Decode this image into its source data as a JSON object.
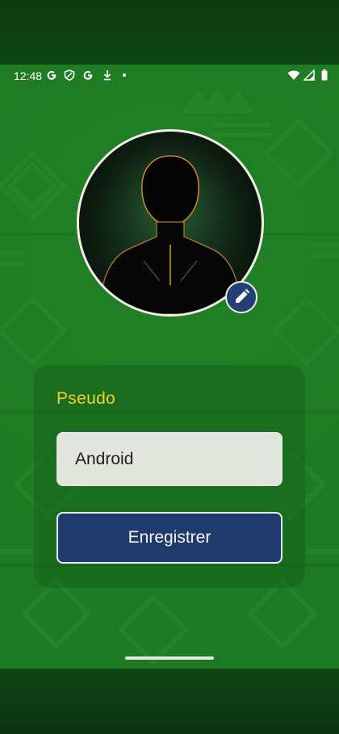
{
  "status_bar": {
    "time": "12:48",
    "left_icons": [
      "google-g-icon",
      "shield-icon",
      "google-g-icon",
      "download-arrow-icon",
      "dot-icon"
    ],
    "right_icons": [
      "wifi-icon",
      "signal-icon",
      "battery-icon"
    ]
  },
  "profile": {
    "avatar": "silhouette-avatar",
    "edit_icon": "pencil-icon"
  },
  "form": {
    "label": "Pseudo",
    "input_value": "Android",
    "save_label": "Enregistrer"
  },
  "colors": {
    "background": "#1e7a22",
    "label": "#f1d32b",
    "button": "#213a6c",
    "input": "#e3e6df"
  }
}
